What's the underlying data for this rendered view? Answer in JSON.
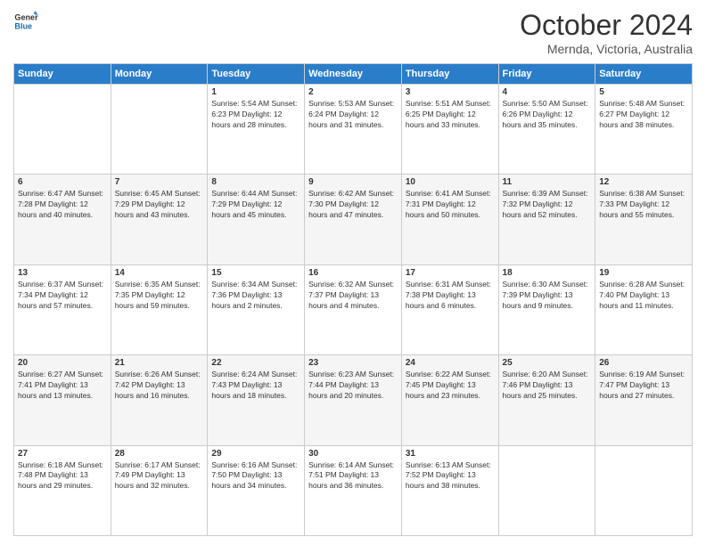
{
  "header": {
    "logo_line1": "General",
    "logo_line2": "Blue",
    "month": "October 2024",
    "location": "Mernda, Victoria, Australia"
  },
  "weekdays": [
    "Sunday",
    "Monday",
    "Tuesday",
    "Wednesday",
    "Thursday",
    "Friday",
    "Saturday"
  ],
  "weeks": [
    [
      {
        "day": "",
        "info": ""
      },
      {
        "day": "",
        "info": ""
      },
      {
        "day": "1",
        "info": "Sunrise: 5:54 AM\nSunset: 6:23 PM\nDaylight: 12 hours and 28 minutes."
      },
      {
        "day": "2",
        "info": "Sunrise: 5:53 AM\nSunset: 6:24 PM\nDaylight: 12 hours and 31 minutes."
      },
      {
        "day": "3",
        "info": "Sunrise: 5:51 AM\nSunset: 6:25 PM\nDaylight: 12 hours and 33 minutes."
      },
      {
        "day": "4",
        "info": "Sunrise: 5:50 AM\nSunset: 6:26 PM\nDaylight: 12 hours and 35 minutes."
      },
      {
        "day": "5",
        "info": "Sunrise: 5:48 AM\nSunset: 6:27 PM\nDaylight: 12 hours and 38 minutes."
      }
    ],
    [
      {
        "day": "6",
        "info": "Sunrise: 6:47 AM\nSunset: 7:28 PM\nDaylight: 12 hours and 40 minutes."
      },
      {
        "day": "7",
        "info": "Sunrise: 6:45 AM\nSunset: 7:29 PM\nDaylight: 12 hours and 43 minutes."
      },
      {
        "day": "8",
        "info": "Sunrise: 6:44 AM\nSunset: 7:29 PM\nDaylight: 12 hours and 45 minutes."
      },
      {
        "day": "9",
        "info": "Sunrise: 6:42 AM\nSunset: 7:30 PM\nDaylight: 12 hours and 47 minutes."
      },
      {
        "day": "10",
        "info": "Sunrise: 6:41 AM\nSunset: 7:31 PM\nDaylight: 12 hours and 50 minutes."
      },
      {
        "day": "11",
        "info": "Sunrise: 6:39 AM\nSunset: 7:32 PM\nDaylight: 12 hours and 52 minutes."
      },
      {
        "day": "12",
        "info": "Sunrise: 6:38 AM\nSunset: 7:33 PM\nDaylight: 12 hours and 55 minutes."
      }
    ],
    [
      {
        "day": "13",
        "info": "Sunrise: 6:37 AM\nSunset: 7:34 PM\nDaylight: 12 hours and 57 minutes."
      },
      {
        "day": "14",
        "info": "Sunrise: 6:35 AM\nSunset: 7:35 PM\nDaylight: 12 hours and 59 minutes."
      },
      {
        "day": "15",
        "info": "Sunrise: 6:34 AM\nSunset: 7:36 PM\nDaylight: 13 hours and 2 minutes."
      },
      {
        "day": "16",
        "info": "Sunrise: 6:32 AM\nSunset: 7:37 PM\nDaylight: 13 hours and 4 minutes."
      },
      {
        "day": "17",
        "info": "Sunrise: 6:31 AM\nSunset: 7:38 PM\nDaylight: 13 hours and 6 minutes."
      },
      {
        "day": "18",
        "info": "Sunrise: 6:30 AM\nSunset: 7:39 PM\nDaylight: 13 hours and 9 minutes."
      },
      {
        "day": "19",
        "info": "Sunrise: 6:28 AM\nSunset: 7:40 PM\nDaylight: 13 hours and 11 minutes."
      }
    ],
    [
      {
        "day": "20",
        "info": "Sunrise: 6:27 AM\nSunset: 7:41 PM\nDaylight: 13 hours and 13 minutes."
      },
      {
        "day": "21",
        "info": "Sunrise: 6:26 AM\nSunset: 7:42 PM\nDaylight: 13 hours and 16 minutes."
      },
      {
        "day": "22",
        "info": "Sunrise: 6:24 AM\nSunset: 7:43 PM\nDaylight: 13 hours and 18 minutes."
      },
      {
        "day": "23",
        "info": "Sunrise: 6:23 AM\nSunset: 7:44 PM\nDaylight: 13 hours and 20 minutes."
      },
      {
        "day": "24",
        "info": "Sunrise: 6:22 AM\nSunset: 7:45 PM\nDaylight: 13 hours and 23 minutes."
      },
      {
        "day": "25",
        "info": "Sunrise: 6:20 AM\nSunset: 7:46 PM\nDaylight: 13 hours and 25 minutes."
      },
      {
        "day": "26",
        "info": "Sunrise: 6:19 AM\nSunset: 7:47 PM\nDaylight: 13 hours and 27 minutes."
      }
    ],
    [
      {
        "day": "27",
        "info": "Sunrise: 6:18 AM\nSunset: 7:48 PM\nDaylight: 13 hours and 29 minutes."
      },
      {
        "day": "28",
        "info": "Sunrise: 6:17 AM\nSunset: 7:49 PM\nDaylight: 13 hours and 32 minutes."
      },
      {
        "day": "29",
        "info": "Sunrise: 6:16 AM\nSunset: 7:50 PM\nDaylight: 13 hours and 34 minutes."
      },
      {
        "day": "30",
        "info": "Sunrise: 6:14 AM\nSunset: 7:51 PM\nDaylight: 13 hours and 36 minutes."
      },
      {
        "day": "31",
        "info": "Sunrise: 6:13 AM\nSunset: 7:52 PM\nDaylight: 13 hours and 38 minutes."
      },
      {
        "day": "",
        "info": ""
      },
      {
        "day": "",
        "info": ""
      }
    ]
  ]
}
